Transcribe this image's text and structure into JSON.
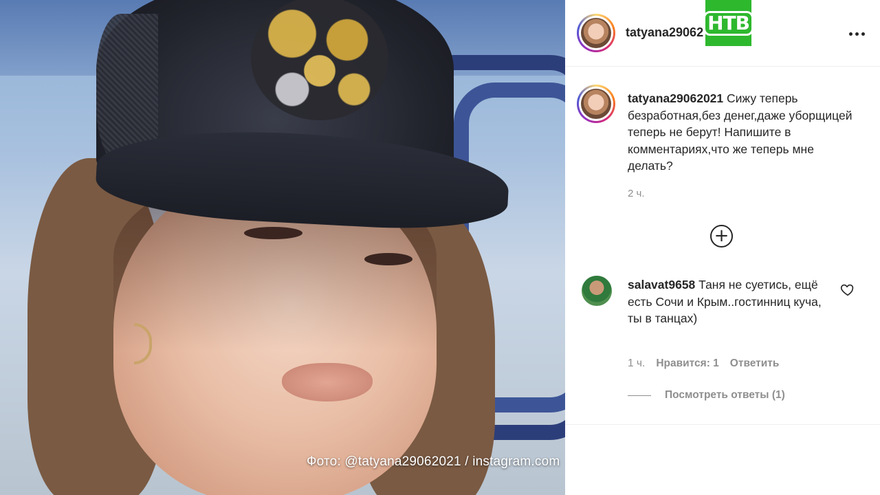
{
  "photo": {
    "caption": "Фото: @tatyana29062021 / instagram.com"
  },
  "brand": {
    "logo_text": "НТВ",
    "logo_color": "#2eb82e"
  },
  "header": {
    "username": "tatyana29062",
    "more_icon": "more-horizontal-icon"
  },
  "post": {
    "username": "tatyana29062021",
    "text": "Сижу теперь безработная,без денег,даже уборщицей теперь не берут! Напишите в комментариях,что же теперь мне делать?",
    "time": "2 ч."
  },
  "load_more": {
    "icon": "plus-circle-icon"
  },
  "comment": {
    "username": "salavat9658",
    "text": "Таня не суетись, ещё есть Сочи и Крым..гостинниц куча, ты в танцах)",
    "time": "1 ч.",
    "likes_label": "Нравится: 1",
    "reply_label": "Ответить",
    "view_replies": "Посмотреть ответы (1)",
    "like_icon": "heart-outline-icon"
  },
  "colors": {
    "text_primary": "#262626",
    "text_secondary": "#8e8e8e",
    "border": "#efefef"
  }
}
